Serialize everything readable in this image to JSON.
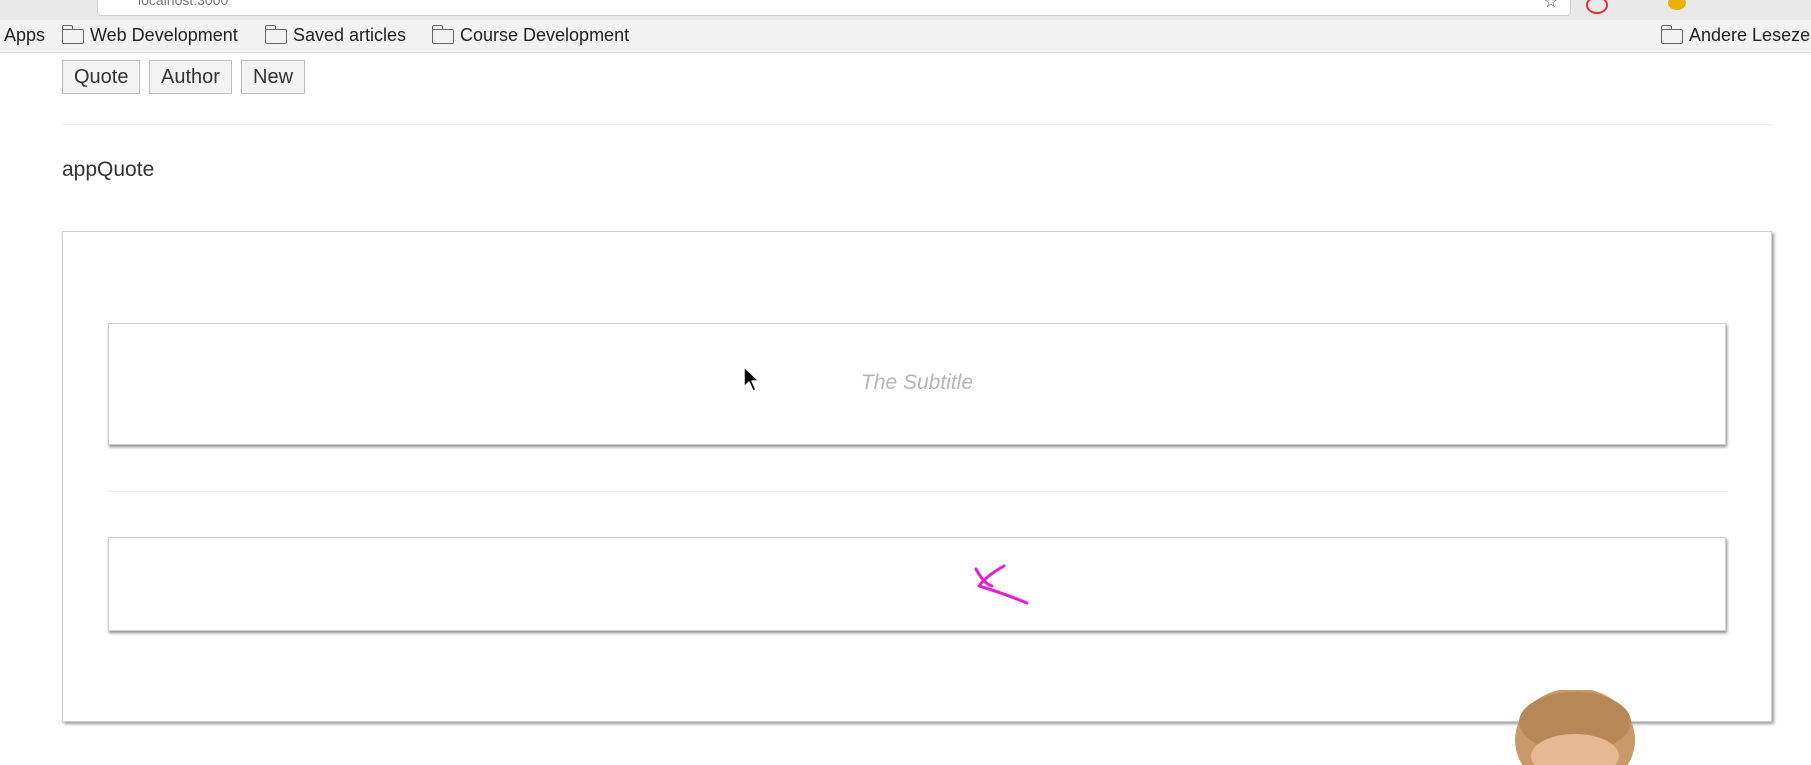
{
  "browser": {
    "address": "localhost:3000",
    "bookmarks": {
      "apps_label": "Apps",
      "items": [
        {
          "label": "Web Development"
        },
        {
          "label": "Saved articles"
        },
        {
          "label": "Course Development"
        }
      ],
      "right_item": "Andere Leseze"
    }
  },
  "app": {
    "nav": {
      "quote_label": "Quote",
      "author_label": "Author",
      "new_label": "New"
    },
    "component_label": "appQuote",
    "subtitle_placeholder": "The Subtitle"
  },
  "colors": {
    "annotation": "#e21ed6",
    "border": "#cfcfcf",
    "placeholder": "#b5b5b5"
  }
}
